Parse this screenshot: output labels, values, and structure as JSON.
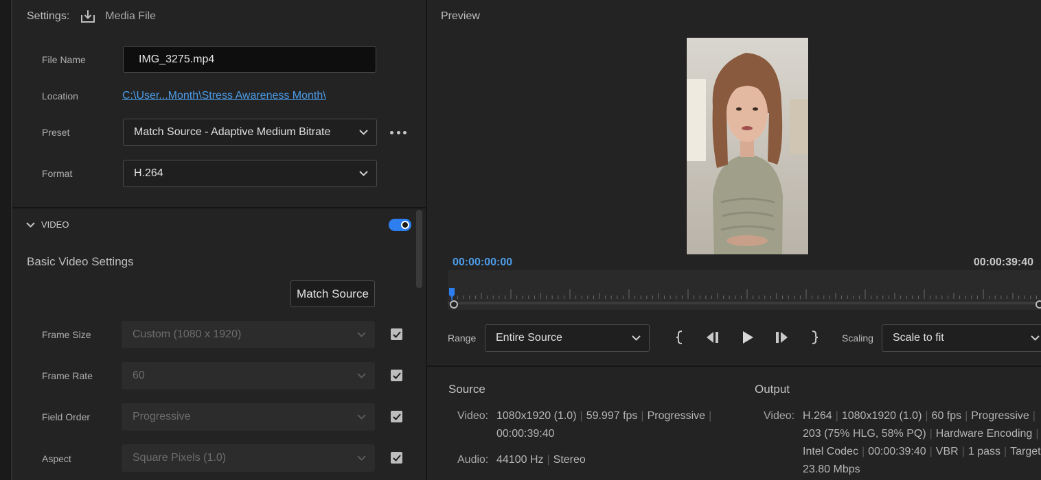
{
  "settings": {
    "label": "Settings:",
    "media_label": "Media File",
    "file_name": {
      "label": "File Name",
      "value": "IMG_3275.mp4"
    },
    "location": {
      "label": "Location",
      "value": "C:\\User...Month\\Stress Awareness Month\\"
    },
    "preset": {
      "label": "Preset",
      "value": "Match Source - Adaptive Medium Bitrate"
    },
    "format": {
      "label": "Format",
      "value": "H.264"
    }
  },
  "video_section": {
    "title": "VIDEO",
    "enabled": true,
    "subsection": "Basic Video Settings",
    "match_source_label": "Match Source",
    "rows": [
      {
        "label": "Frame Size",
        "value": "Custom (1080 x 1920)",
        "checked": true
      },
      {
        "label": "Frame Rate",
        "value": "60",
        "checked": true
      },
      {
        "label": "Field Order",
        "value": "Progressive",
        "checked": true
      },
      {
        "label": "Aspect",
        "value": "Square Pixels (1.0)",
        "checked": true
      }
    ]
  },
  "preview": {
    "title": "Preview",
    "current_time": "00:00:00:00",
    "duration": "00:00:39:40",
    "range_label": "Range",
    "range_value": "Entire Source",
    "scaling_label": "Scaling",
    "scaling_value": "Scale to fit"
  },
  "source": {
    "title": "Source",
    "video_label": "Video:",
    "video_line1": [
      "1080x1920 (1.0)",
      "59.997 fps",
      "Progressive"
    ],
    "video_line2": "00:00:39:40",
    "audio_label": "Audio:",
    "audio_values": [
      "44100 Hz",
      "Stereo"
    ]
  },
  "output": {
    "title": "Output",
    "video_label": "Video:",
    "line1": [
      "H.264",
      "1080x1920 (1.0)",
      "60 fps",
      "Progressive"
    ],
    "line2": [
      "203 (75% HLG, 58% PQ)",
      "Hardware Encoding"
    ],
    "line3": [
      "Intel Codec",
      "00:00:39:40",
      "VBR",
      "1 pass",
      "Target"
    ],
    "line4": "23.80 Mbps"
  },
  "colors": {
    "accent": "#4c9ce8",
    "toggle_on": "#2d7ff0",
    "panel_bg": "#232323"
  }
}
